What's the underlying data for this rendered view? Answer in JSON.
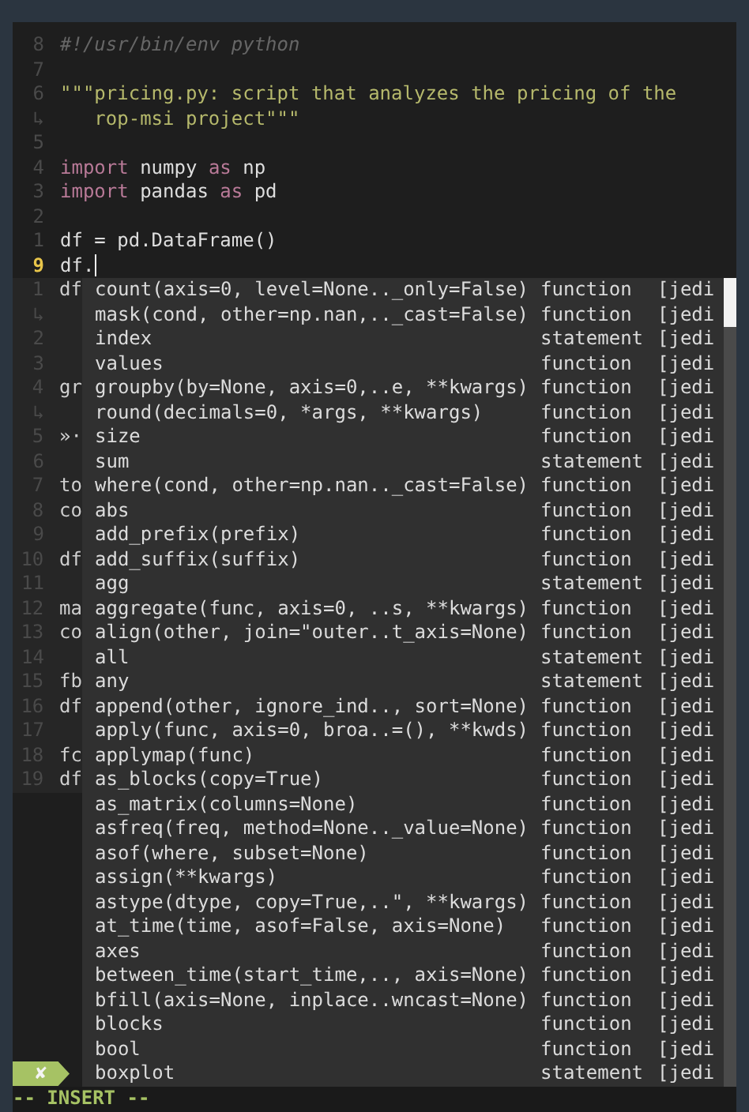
{
  "editor": {
    "lines": [
      {
        "gutter": "8",
        "current": false,
        "segments": [
          {
            "kind": "comment",
            "text": "#!/usr/bin/env python"
          }
        ]
      },
      {
        "gutter": "7",
        "current": false
      },
      {
        "gutter": "6",
        "current": false,
        "segments": [
          {
            "kind": "string",
            "text": "\"\"\"pricing.py: script that analyzes the pricing of the"
          }
        ]
      },
      {
        "gutter": "↳",
        "current": false,
        "segments": [
          {
            "kind": "string",
            "text": "   rop-msi project\"\"\""
          }
        ]
      },
      {
        "gutter": "5",
        "current": false
      },
      {
        "gutter": "4",
        "current": false,
        "segments": [
          {
            "kind": "keyword",
            "text": "import"
          },
          {
            "kind": "plain",
            "text": " numpy "
          },
          {
            "kind": "keyword",
            "text": "as"
          },
          {
            "kind": "plain",
            "text": " np"
          }
        ]
      },
      {
        "gutter": "3",
        "current": false,
        "segments": [
          {
            "kind": "keyword",
            "text": "import"
          },
          {
            "kind": "plain",
            "text": " pandas "
          },
          {
            "kind": "keyword",
            "text": "as"
          },
          {
            "kind": "plain",
            "text": " pd"
          }
        ]
      },
      {
        "gutter": "2",
        "current": false
      },
      {
        "gutter": "1",
        "current": false,
        "segments": [
          {
            "kind": "plain",
            "text": "df = pd.DataFrame()"
          }
        ]
      },
      {
        "gutter": "9",
        "current": true,
        "segments": [
          {
            "kind": "plain",
            "text": "df."
          }
        ]
      }
    ],
    "hidden_gutter": [
      {
        "number": "1",
        "text": "df"
      },
      {
        "number": "↳"
      },
      {
        "number": "2"
      },
      {
        "number": "3"
      },
      {
        "number": "4",
        "text": "gr"
      },
      {
        "number": "↳"
      },
      {
        "number": "5",
        "text": "»·"
      },
      {
        "number": "6"
      },
      {
        "number": "7",
        "text": "to"
      },
      {
        "number": "8",
        "text": "co"
      },
      {
        "number": "9"
      },
      {
        "number": "10",
        "text": "df"
      },
      {
        "number": "11"
      },
      {
        "number": "12",
        "text": "ma"
      },
      {
        "number": "13",
        "text": "co"
      },
      {
        "number": "14"
      },
      {
        "number": "15",
        "text": "fb"
      },
      {
        "number": "16",
        "text": "df"
      },
      {
        "number": "17"
      },
      {
        "number": "18",
        "text": "fc"
      },
      {
        "number": "19",
        "text": "df"
      }
    ]
  },
  "completions": [
    {
      "name": "count(axis=0, level=None.._only=False)",
      "kind": "function",
      "source": "[jedi"
    },
    {
      "name": "mask(cond, other=np.nan,.._cast=False)",
      "kind": "function",
      "source": "[jedi"
    },
    {
      "name": "index",
      "kind": "statement",
      "source": "[jedi"
    },
    {
      "name": "values",
      "kind": "function",
      "source": "[jedi"
    },
    {
      "name": "groupby(by=None, axis=0,..e, **kwargs)",
      "kind": "function",
      "source": "[jedi"
    },
    {
      "name": "round(decimals=0, *args, **kwargs)",
      "kind": "function",
      "source": "[jedi"
    },
    {
      "name": "size",
      "kind": "function",
      "source": "[jedi"
    },
    {
      "name": "sum",
      "kind": "statement",
      "source": "[jedi"
    },
    {
      "name": "where(cond, other=np.nan.._cast=False)",
      "kind": "function",
      "source": "[jedi"
    },
    {
      "name": "abs",
      "kind": "function",
      "source": "[jedi"
    },
    {
      "name": "add_prefix(prefix)",
      "kind": "function",
      "source": "[jedi"
    },
    {
      "name": "add_suffix(suffix)",
      "kind": "function",
      "source": "[jedi"
    },
    {
      "name": "agg",
      "kind": "statement",
      "source": "[jedi"
    },
    {
      "name": "aggregate(func, axis=0, ..s, **kwargs)",
      "kind": "function",
      "source": "[jedi"
    },
    {
      "name": "align(other, join=\"outer..t_axis=None)",
      "kind": "function",
      "source": "[jedi"
    },
    {
      "name": "all",
      "kind": "statement",
      "source": "[jedi"
    },
    {
      "name": "any",
      "kind": "statement",
      "source": "[jedi"
    },
    {
      "name": "append(other, ignore_ind.., sort=None)",
      "kind": "function",
      "source": "[jedi"
    },
    {
      "name": "apply(func, axis=0, broa..=(), **kwds)",
      "kind": "function",
      "source": "[jedi"
    },
    {
      "name": "applymap(func)",
      "kind": "function",
      "source": "[jedi"
    },
    {
      "name": "as_blocks(copy=True)",
      "kind": "function",
      "source": "[jedi"
    },
    {
      "name": "as_matrix(columns=None)",
      "kind": "function",
      "source": "[jedi"
    },
    {
      "name": "asfreq(freq, method=None.._value=None)",
      "kind": "function",
      "source": "[jedi"
    },
    {
      "name": "asof(where, subset=None)",
      "kind": "function",
      "source": "[jedi"
    },
    {
      "name": "assign(**kwargs)",
      "kind": "function",
      "source": "[jedi"
    },
    {
      "name": "astype(dtype, copy=True,..\", **kwargs)",
      "kind": "function",
      "source": "[jedi"
    },
    {
      "name": "at_time(time, asof=False, axis=None)",
      "kind": "function",
      "source": "[jedi"
    },
    {
      "name": "axes",
      "kind": "function",
      "source": "[jedi"
    },
    {
      "name": "between_time(start_time,.., axis=None)",
      "kind": "function",
      "source": "[jedi"
    },
    {
      "name": "bfill(axis=None, inplace..wncast=None)",
      "kind": "function",
      "source": "[jedi"
    },
    {
      "name": "blocks",
      "kind": "function",
      "source": "[jedi"
    },
    {
      "name": "bool",
      "kind": "function",
      "source": "[jedi"
    },
    {
      "name": "boxplot",
      "kind": "statement",
      "source": "[jedi"
    }
  ],
  "statusline": {
    "segment": "✘"
  },
  "mode": "-- INSERT --"
}
